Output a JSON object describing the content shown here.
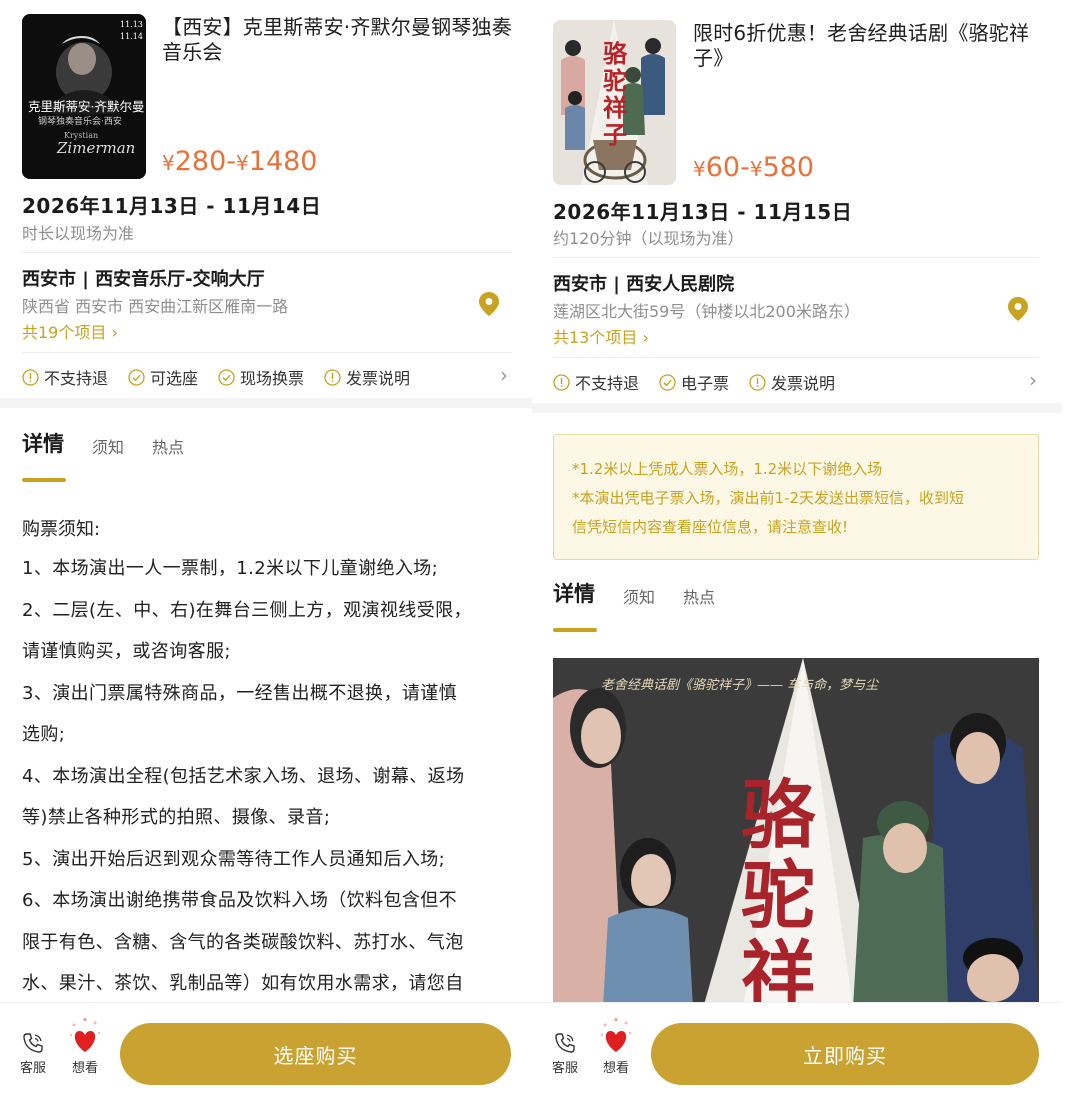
{
  "left": {
    "title": "【西安】克里斯蒂安·齐默尔曼钢琴独奏音乐会",
    "poster_text": {
      "dates": [
        "11.13",
        "11.14"
      ],
      "title": "克里斯蒂安·齐默尔曼",
      "subtitle": "钢琴独奏音乐会·西安",
      "name_en_1": "Krystian",
      "name_en_2": "Zimerman"
    },
    "price": {
      "symbol": "¥",
      "low": "280",
      "sep": "-",
      "high": "1480"
    },
    "date": "2026年11月13日 - 11月14日",
    "duration": "时长以现场为准",
    "venue": "西安市 | 西安音乐厅-交响大厅",
    "address": "陕西省 西安市 西安曲江新区雁南一路",
    "items_link": "共19个项目 ›",
    "tags": [
      "不支持退",
      "可选座",
      "现场换票",
      "发票说明"
    ],
    "tabs": {
      "active": "详情",
      "t2": "须知",
      "t3": "热点"
    },
    "notice_heading": "购票须知:",
    "notice_lines": [
      "1、本场演出一人一票制，1.2米以下儿童谢绝入场;",
      "2、二层(左、中、右)在舞台三侧上方，观演视线受限，",
      "请谨慎购买，或咨询客服;",
      "3、演出门票属特殊商品，一经售出概不退换，请谨慎",
      "选购;",
      "4、本场演出全程(包括艺术家入场、退场、谢幕、返场",
      "等)禁止各种形式的拍照、摄像、录音;",
      "5、演出开始后迟到观众需等待工作人员通知后入场;",
      "6、本场演出谢绝携带食品及饮料入场（饮料包含但不",
      "限于有色、含糖、含气的各类碳酸饮料、苏打水、气泡",
      "水、果汁、茶饮、乳制品等）如有饮用水需求，请您自"
    ],
    "bottom": {
      "service": "客服",
      "want": "想看",
      "buy": "选座购买"
    }
  },
  "right": {
    "title": "限时6折优惠！老舍经典话剧《骆驼祥子》",
    "poster_text": {
      "title": "骆驼祥子"
    },
    "price": {
      "symbol": "¥",
      "low": "60",
      "sep": "-",
      "high": "580"
    },
    "date": "2026年11月13日 - 11月15日",
    "duration": "约120分钟（以现场为准）",
    "venue": "西安市 | 西安人民剧院",
    "address": "莲湖区北大街59号（钟楼以北200米路东）",
    "items_link": "共13个项目 ›",
    "tags": [
      "不支持退",
      "电子票",
      "发票说明"
    ],
    "tip_lines": [
      "*1.2米以上凭成人票入场，1.2米以下谢绝入场",
      "*本演出凭电子票入场，演出前1-2天发送出票短信，收到短",
      "信凭短信内容查看座位信息，请注意查收!"
    ],
    "tabs": {
      "active": "详情",
      "t2": "须知",
      "t3": "热点"
    },
    "banner_text": {
      "caption": "老舍经典话剧《骆驼祥子》——  车与命，梦与尘",
      "c1": "骆",
      "c2": "驼",
      "c3": "祥"
    },
    "bottom": {
      "service": "客服",
      "want": "想看",
      "buy": "立即购买"
    }
  },
  "colors": {
    "accent": "#c9a21f",
    "price": "#e8733a",
    "button": "#c9a232",
    "heart": "#e02020"
  }
}
